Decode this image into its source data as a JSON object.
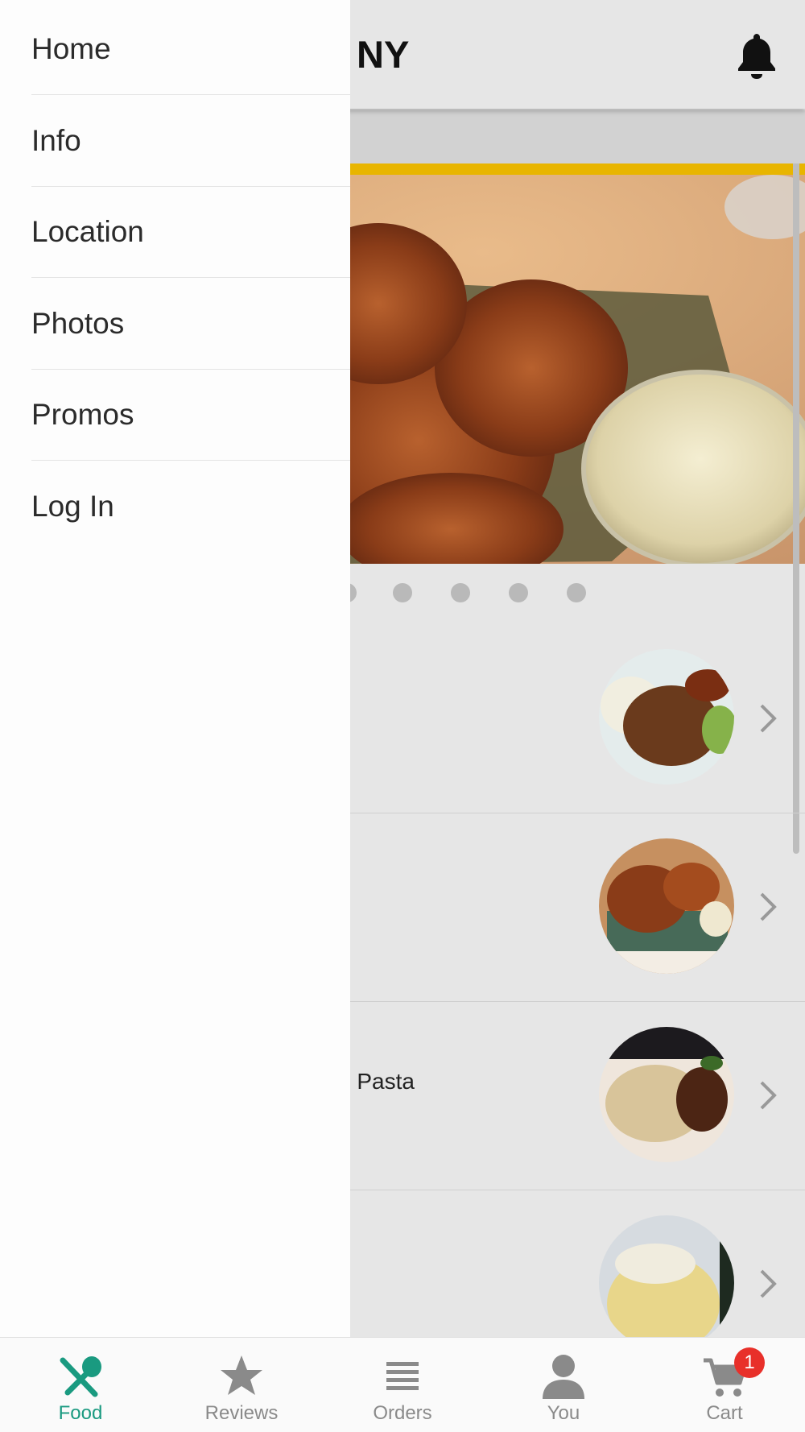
{
  "header": {
    "title": "NY",
    "bell_icon": "bell-icon"
  },
  "colors": {
    "accent": "#e8b500",
    "active_tab": "#1a9a80",
    "badge": "#e8302a",
    "drawer_bg": "#fdfdfd"
  },
  "drawer": {
    "items": [
      {
        "label": "Home"
      },
      {
        "label": "Info"
      },
      {
        "label": "Location"
      },
      {
        "label": "Photos"
      },
      {
        "label": "Promos"
      },
      {
        "label": "Log In"
      }
    ]
  },
  "menu": {
    "rows": [
      {
        "label": ""
      },
      {
        "label": ""
      },
      {
        "label": "e Pasta"
      },
      {
        "label": ""
      }
    ]
  },
  "bottom_nav": {
    "items": [
      {
        "label": "Food",
        "icon": "fork-spoon-icon",
        "active": true
      },
      {
        "label": "Reviews",
        "icon": "star-icon",
        "active": false
      },
      {
        "label": "Orders",
        "icon": "list-icon",
        "active": false
      },
      {
        "label": "You",
        "icon": "person-icon",
        "active": false
      },
      {
        "label": "Cart",
        "icon": "cart-icon",
        "active": false,
        "badge": "1"
      }
    ]
  }
}
